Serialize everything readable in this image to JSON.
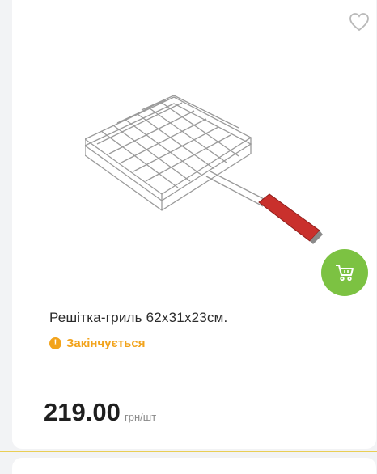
{
  "product": {
    "title": "Решітка-гриль 62х31х23см.",
    "stock_status": "Закінчується",
    "price": "219.00",
    "unit": "грн/шт",
    "image_icon": "grill-basket-image"
  },
  "icons": {
    "favorite": "heart-icon",
    "cart": "cart-icon",
    "warning": "exclamation-icon"
  },
  "colors": {
    "cart_button": "#7cc242",
    "stock_warning": "#f2a31b",
    "divider": "#e9ce55"
  }
}
